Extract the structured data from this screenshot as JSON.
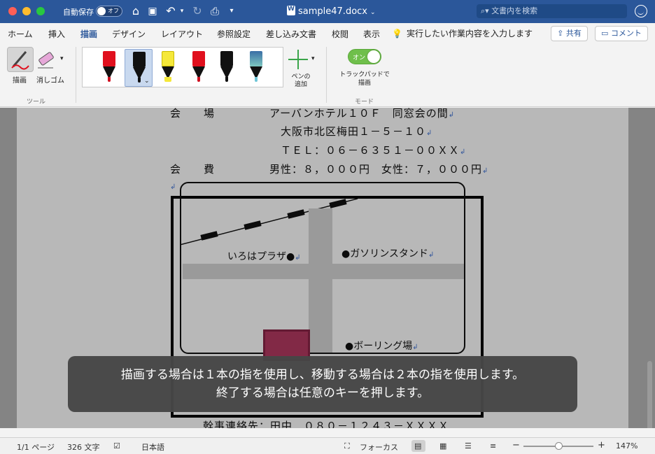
{
  "titlebar": {
    "autosave_label": "自動保存",
    "autosave_state": "オフ",
    "doc_title": "sample47.docx",
    "search_placeholder": "文書内を検索"
  },
  "tabs": [
    {
      "label": "ホーム"
    },
    {
      "label": "挿入"
    },
    {
      "label": "描画"
    },
    {
      "label": "デザイン"
    },
    {
      "label": "レイアウト"
    },
    {
      "label": "参照設定"
    },
    {
      "label": "差し込み文書"
    },
    {
      "label": "校閲"
    },
    {
      "label": "表示"
    }
  ],
  "active_tab": "描画",
  "tell_me": "実行したい作業内容を入力します",
  "share_label": "共有",
  "comment_label": "コメント",
  "ribbon": {
    "draw_label": "描画",
    "eraser_label": "消しゴム",
    "tools_group": "ツール",
    "add_pen_label": "ペンの追加",
    "trackpad_toggle": "オン",
    "trackpad_label": "トラックパッドで描画",
    "mode_group": "モード",
    "pens": [
      {
        "name": "red-pen",
        "color": "#e0101e",
        "tip": "#d01020"
      },
      {
        "name": "black-pen",
        "color": "#111111",
        "tip": "#111111"
      },
      {
        "name": "yellow-highlighter",
        "color": "#f5e83a",
        "tip": "#f5e83a"
      },
      {
        "name": "red-pencil",
        "color": "#e0101e",
        "tip": "#d01020"
      },
      {
        "name": "black-pencil",
        "color": "#111111",
        "tip": "#111111"
      },
      {
        "name": "galaxy-pen",
        "color": "#3a6ea5",
        "tip": "#6fc6d8"
      }
    ]
  },
  "document": {
    "line1_label": "会　　場",
    "line1_value": "アーバンホテル１０Ｆ　同窓会の間",
    "line2": "大阪市北区梅田１－５－１０",
    "line3": "ＴＥＬ：０６－６３５１－００ＸＸ",
    "line4_label": "会　　費",
    "line4_value": "男性：８，０００円　女性：７，０００円",
    "map": {
      "iroha": "いろはプラザ●",
      "gas": "●ガソリンスタンド",
      "bowling": "●ボーリング場"
    },
    "bottom_line": "幹事連絡先：田中　０８０－１２４３－ＸＸＸＸ"
  },
  "overlay_message": {
    "line1": "描画する場合は１本の指を使用し、移動する場合は２本の指を使用します。",
    "line2": "終了する場合は任意のキーを押します。"
  },
  "statusbar": {
    "page": "1/1 ページ",
    "words": "326 文字",
    "language": "日本語",
    "focus": "フォーカス",
    "zoom": "147%",
    "zoom_fraction": 0.5
  }
}
